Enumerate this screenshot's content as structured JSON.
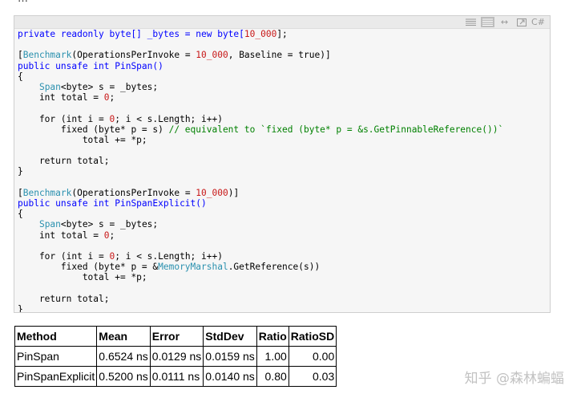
{
  "top_fragment": "…",
  "toolbar": {
    "icons": [
      "view-source-icon",
      "copy-icon",
      "expand-icon",
      "popup-icon",
      "language-icon"
    ],
    "language": "C#"
  },
  "code": {
    "lines": [
      [
        {
          "t": "private readonly byte[] _bytes = new byte[",
          "c": "kw"
        },
        {
          "t": "10_000",
          "c": "num"
        },
        {
          "t": "];",
          "c": ""
        }
      ],
      [],
      [
        {
          "t": "[",
          "c": ""
        },
        {
          "t": "Benchmark",
          "c": "ty"
        },
        {
          "t": "(OperationsPerInvoke = ",
          "c": ""
        },
        {
          "t": "10_000",
          "c": "num"
        },
        {
          "t": ", Baseline = true)]",
          "c": ""
        }
      ],
      [
        {
          "t": "public unsafe int PinSpan()",
          "c": "kw"
        }
      ],
      [
        {
          "t": "{",
          "c": ""
        }
      ],
      [
        {
          "t": "    ",
          "c": ""
        },
        {
          "t": "Span",
          "c": "ty"
        },
        {
          "t": "<byte> s = _bytes;",
          "c": ""
        }
      ],
      [
        {
          "t": "    int total = ",
          "c": ""
        },
        {
          "t": "0",
          "c": "num"
        },
        {
          "t": ";",
          "c": ""
        }
      ],
      [],
      [
        {
          "t": "    for (int i = ",
          "c": ""
        },
        {
          "t": "0",
          "c": "num"
        },
        {
          "t": "; i < s.Length; i++)",
          "c": ""
        }
      ],
      [
        {
          "t": "        fixed (byte* p = s) ",
          "c": ""
        },
        {
          "t": "// equivalent to `fixed (byte* p = &s.GetPinnableReference())`",
          "c": "cm"
        }
      ],
      [
        {
          "t": "            total += *p;",
          "c": ""
        }
      ],
      [],
      [
        {
          "t": "    return total;",
          "c": ""
        }
      ],
      [
        {
          "t": "}",
          "c": ""
        }
      ],
      [],
      [
        {
          "t": "[",
          "c": ""
        },
        {
          "t": "Benchmark",
          "c": "ty"
        },
        {
          "t": "(OperationsPerInvoke = ",
          "c": ""
        },
        {
          "t": "10_000",
          "c": "num"
        },
        {
          "t": ")]",
          "c": ""
        }
      ],
      [
        {
          "t": "public unsafe int PinSpanExplicit()",
          "c": "kw"
        }
      ],
      [
        {
          "t": "{",
          "c": ""
        }
      ],
      [
        {
          "t": "    ",
          "c": ""
        },
        {
          "t": "Span",
          "c": "ty"
        },
        {
          "t": "<byte> s = _bytes;",
          "c": ""
        }
      ],
      [
        {
          "t": "    int total = ",
          "c": ""
        },
        {
          "t": "0",
          "c": "num"
        },
        {
          "t": ";",
          "c": ""
        }
      ],
      [],
      [
        {
          "t": "    for (int i = ",
          "c": ""
        },
        {
          "t": "0",
          "c": "num"
        },
        {
          "t": "; i < s.Length; i++)",
          "c": ""
        }
      ],
      [
        {
          "t": "        fixed (byte* p = &",
          "c": ""
        },
        {
          "t": "MemoryMarshal",
          "c": "ty"
        },
        {
          "t": ".GetReference(s))",
          "c": ""
        }
      ],
      [
        {
          "t": "            total += *p;",
          "c": ""
        }
      ],
      [],
      [
        {
          "t": "    return total;",
          "c": ""
        }
      ],
      [
        {
          "t": "}",
          "c": ""
        }
      ]
    ]
  },
  "table": {
    "headers": [
      "Method",
      "Mean",
      "Error",
      "StdDev",
      "Ratio",
      "RatioSD"
    ],
    "rows": [
      [
        "PinSpan",
        "0.6524 ns",
        "0.0129 ns",
        "0.0159 ns",
        "1.00",
        "0.00"
      ],
      [
        "PinSpanExplicit",
        "0.5200 ns",
        "0.0111 ns",
        "0.0140 ns",
        "0.80",
        "0.03"
      ]
    ]
  },
  "watermark": "知乎 @森林蝙蝠"
}
